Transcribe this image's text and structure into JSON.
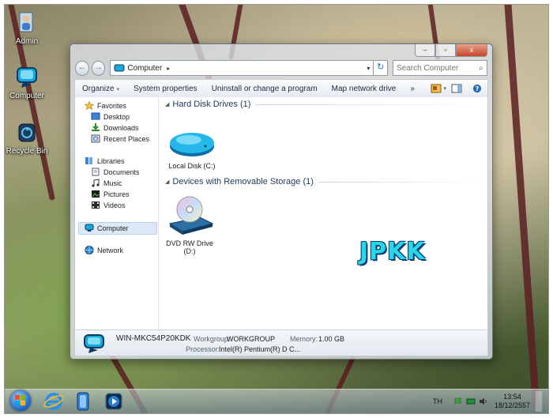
{
  "desktop": {
    "icons": [
      {
        "label": "Admin",
        "icon": "user-folder-icon"
      },
      {
        "label": "Computer",
        "icon": "computer-icon"
      },
      {
        "label": "Recycle Bin",
        "icon": "recycle-bin-icon"
      }
    ]
  },
  "window": {
    "caption_buttons": {
      "minimize": "–",
      "maximize": "▫",
      "close": "x"
    },
    "nav": {
      "back": "back-arrow-icon",
      "forward": "forward-arrow-icon"
    },
    "address": {
      "location": "Computer",
      "separator": "▸",
      "dropdown": "▾"
    },
    "refresh": "↻",
    "search": {
      "placeholder": "Search Computer",
      "value": ""
    },
    "toolbar": {
      "organize": "Organize",
      "organize_arrow": "▾",
      "system_properties": "System properties",
      "uninstall": "Uninstall or change a program",
      "map_drive": "Map network drive",
      "more": "»"
    },
    "sidebar": {
      "favorites": "Favorites",
      "favorites_items": [
        "Desktop",
        "Downloads",
        "Recent Places"
      ],
      "libraries": "Libraries",
      "libraries_items": [
        "Documents",
        "Music",
        "Pictures",
        "Videos"
      ],
      "computer": "Computer",
      "network": "Network"
    },
    "groups": {
      "hdd": "Hard Disk Drives (1)",
      "removable": "Devices with Removable Storage (1)"
    },
    "drives": {
      "local": "Local Disk (C:)",
      "dvd_line1": "DVD RW Drive",
      "dvd_line2": "(D:)"
    },
    "watermark": "JPKK",
    "details": {
      "name": "WIN-MKC54P20KDK",
      "workgroup_label": "Workgroup:",
      "workgroup": "WORKGROUP",
      "memory_label": "Memory:",
      "memory": "1.00 GB",
      "processor_label": "Processor:",
      "processor": "Intel(R) Pentium(R) D C..."
    }
  },
  "taskbar": {
    "apps": [
      "internet-explorer-icon",
      "windows-explorer-icon",
      "media-player-icon"
    ],
    "language": "TH",
    "time": "13:54",
    "date": "18/12/2557"
  },
  "colors": {
    "accent": "#2a6ebb",
    "watermark": "#27d7e6",
    "close_button": "#c8462c"
  }
}
